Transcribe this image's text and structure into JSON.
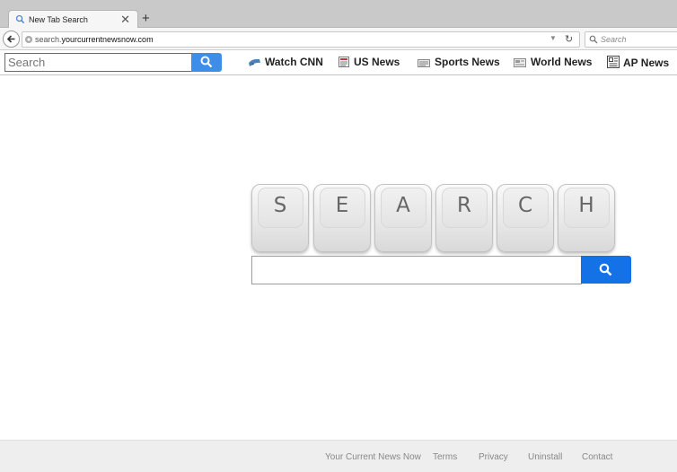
{
  "browser": {
    "tab": {
      "title": "New Tab Search",
      "close": "✕",
      "icon": "search-icon"
    },
    "new_tab": "+",
    "url": {
      "prefix": "search.",
      "domain": "yourcurrentnewsnow.com"
    },
    "search_placeholder": "Search"
  },
  "toolbar": {
    "search_placeholder": "Search",
    "links": [
      {
        "label": "Watch CNN",
        "icon": "cnn-icon"
      },
      {
        "label": "US News",
        "icon": "newspaper-icon"
      },
      {
        "label": "Sports News",
        "icon": "newspaper-icon"
      },
      {
        "label": "World News",
        "icon": "newspaper-icon"
      },
      {
        "label": "AP News",
        "icon": "newspaper-icon"
      }
    ]
  },
  "hero": {
    "keys": [
      "S",
      "E",
      "A",
      "R",
      "C",
      "H"
    ]
  },
  "footer": {
    "links": [
      "Your Current News Now",
      "Terms",
      "Privacy",
      "Uninstall",
      "Contact"
    ]
  },
  "colors": {
    "search_button": "#1471e6",
    "toolbar_search_button": "#3d8ee8",
    "footer_bg": "#eeeeee"
  }
}
